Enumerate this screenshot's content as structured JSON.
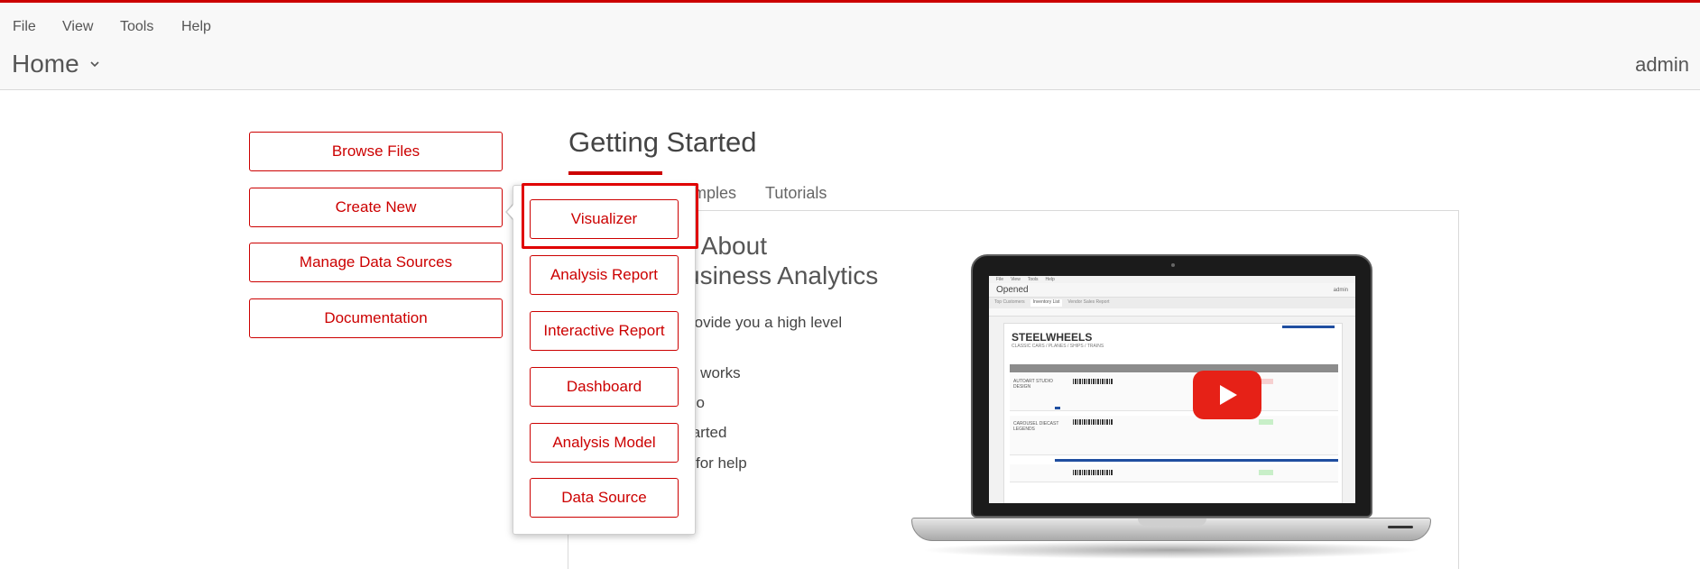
{
  "menubar": {
    "items": [
      "File",
      "View",
      "Tools",
      "Help"
    ]
  },
  "header": {
    "home_label": "Home",
    "user": "admin"
  },
  "left_buttons": [
    "Browse Files",
    "Create New",
    "Manage Data Sources",
    "Documentation"
  ],
  "create_new_menu": {
    "items": [
      "Visualizer",
      "Analysis Report",
      "Interactive Report",
      "Dashboard",
      "Analysis Model",
      "Data Source"
    ],
    "highlighted": "Visualizer"
  },
  "getting_started": {
    "title": "Getting Started",
    "tabs": [
      "mples",
      "Tutorials"
    ],
    "heading_line1": "e About",
    "heading_line2": "usiness Analytics",
    "body": "rovide you a high level",
    "links": [
      "o works",
      "do",
      "tarted",
      "for help"
    ]
  },
  "video_preview": {
    "app_menu": [
      "File",
      "View",
      "Tools",
      "Help"
    ],
    "opened_label": "Opened",
    "admin_label": "admin",
    "tabs": [
      "Top Customers",
      "Inventory List",
      "Vendor Sales Report"
    ],
    "report_title": "STEELWHEELS",
    "report_subtitle": "CLASSIC  CARS  /  PLANES  /  SHIPS  /  TRAINS",
    "rows": [
      "AUTOART STUDIO DESIGN",
      "CAROUSEL DIECAST LEGENDS"
    ],
    "play_icon": "youtube-play-icon"
  },
  "colors": {
    "accent": "#cc0000",
    "highlight": "#e00000",
    "youtube_red": "#e62117"
  }
}
